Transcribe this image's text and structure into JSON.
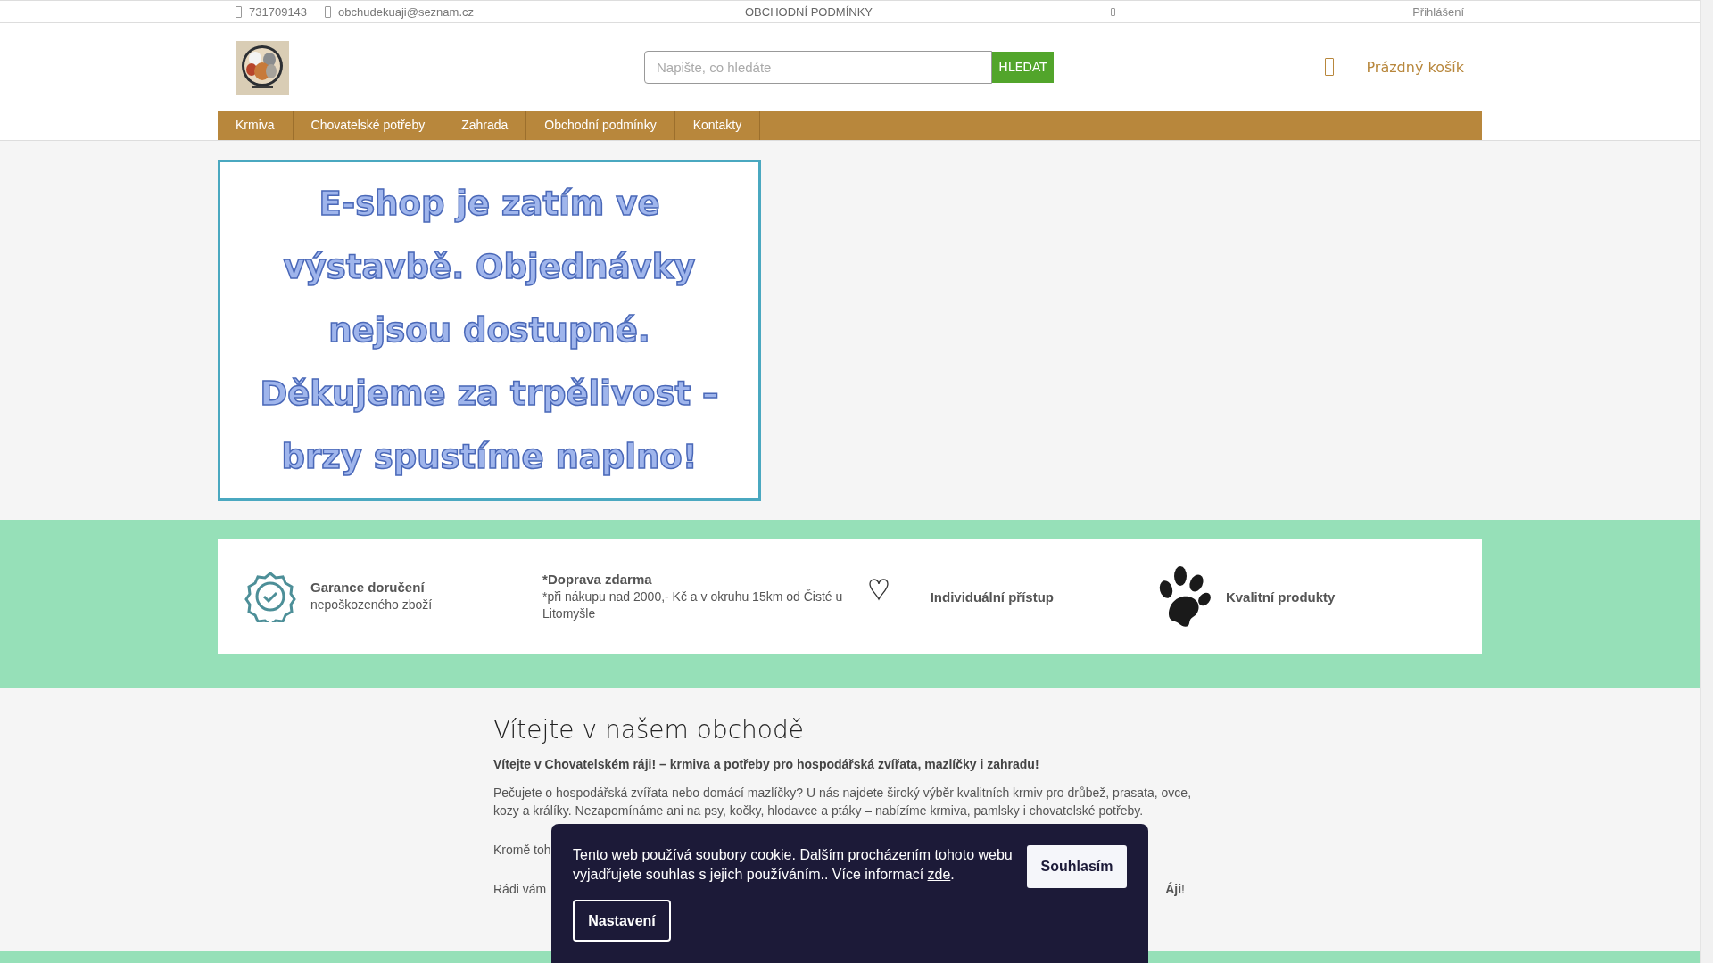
{
  "top_bar": {
    "phone": "731709143",
    "email": "obchudekuaji@seznam.cz",
    "link": "OBCHODNÍ PODMÍNKY",
    "login": "Přihlášení"
  },
  "header": {
    "search": {
      "placeholder": "Napište, co hledáte",
      "button": "HLEDAT"
    },
    "cart": "Prázdný košík"
  },
  "nav": [
    {
      "label": "Krmiva"
    },
    {
      "label": "Chovatelské potřeby"
    },
    {
      "label": "Zahrada"
    },
    {
      "label": "Obchodní podmínky"
    },
    {
      "label": "Kontakty"
    }
  ],
  "banner": {
    "lines": [
      "E-shop je zatím ve",
      "výstavbě. Objednávky",
      "nejsou dostupné.",
      "Děkujeme za trpělivost –",
      "brzy spustíme naplno!"
    ]
  },
  "features": [
    {
      "kind": "badge",
      "title": "Garance doručení",
      "text": "nepoškozeného zboží"
    },
    {
      "kind": "none",
      "title": "*Doprava zdarma",
      "text": "*při nákupu nad 2000,- Kč a v okruhu 15km od Čisté u Litomyšle"
    },
    {
      "kind": "heart",
      "title": "Individuální přístup"
    },
    {
      "kind": "paw",
      "title": "Kvalitní produkty"
    }
  ],
  "welcome": {
    "heading": "Vítejte v našem obchodě",
    "lead": "Vítejte v Chovatelském ráji! – krmiva a potřeby pro hospodářská zvířata, mazlíčky i zahradu!",
    "paragraphs": [
      {
        "left": "Pečujete o hospodářská zvířata nebo domácí mazlíčky? U nás najdete široký výběr kvalitních krmiv pro drůbež, prasata, ovce, kozy a králíky. Nezapomínáme ani na psy, kočky, hlodavce a ptáky – nabízíme krmiva, pamlsky i chovatelské potřeby."
      },
      {
        "left": "Kromě toh"
      },
      {
        "left": "Rádi vám",
        "right": "**Áji**!"
      }
    ]
  },
  "cookie": {
    "text": "Tento web používá soubory cookie. Dalším procházením tohoto webu vyjadřujete souhlas s jejich používáním.. Více informací ",
    "link": "zde",
    "after": ".",
    "accept": "Souhlasím",
    "settings": "Nastavení"
  }
}
